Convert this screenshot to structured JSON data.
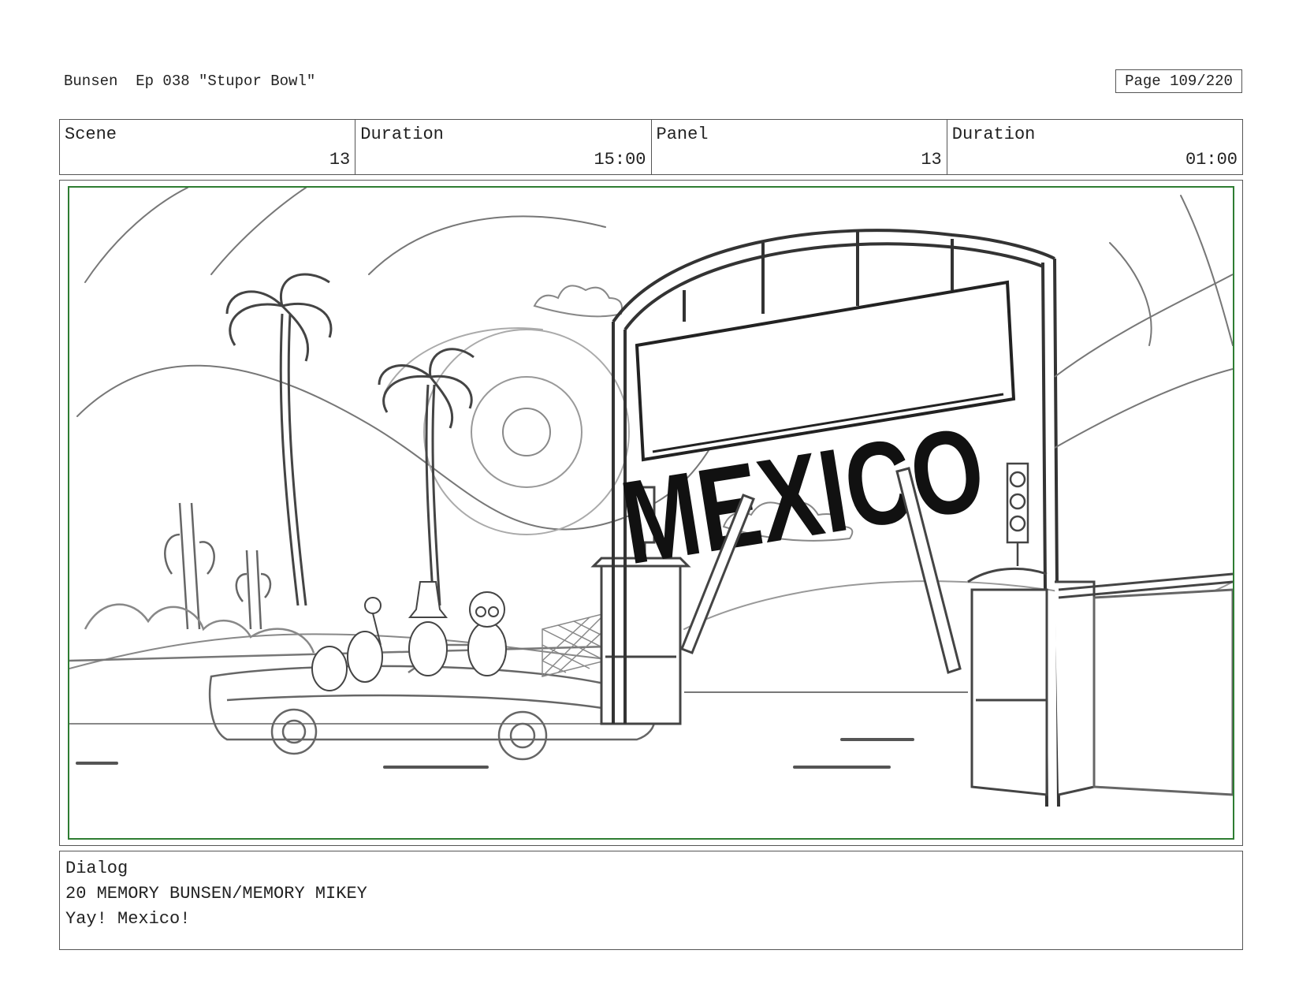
{
  "header": {
    "title": "Bunsen  Ep 038 \"Stupor Bowl\"",
    "page": "Page 109/220"
  },
  "info": {
    "scene_label": "Scene",
    "scene_value": "13",
    "duration1_label": "Duration",
    "duration1_value": "15:00",
    "panel_label": "Panel",
    "panel_value": "13",
    "duration2_label": "Duration",
    "duration2_value": "01:00"
  },
  "panel": {
    "sign_text": "MEXICO"
  },
  "dialog": {
    "label": "Dialog",
    "speaker": "20 MEMORY BUNSEN/MEMORY MIKEY",
    "line": "Yay! Mexico!"
  },
  "colors": {
    "frame_border": "#2e7d32",
    "line": "#555555"
  }
}
